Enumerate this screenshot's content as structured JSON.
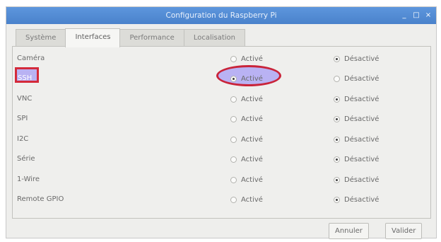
{
  "window": {
    "title": "Configuration du Raspberry Pi",
    "controls": {
      "minimize": "_",
      "maximize": "□",
      "close": "×"
    }
  },
  "tabs": [
    {
      "label": "Système",
      "active": false
    },
    {
      "label": "Interfaces",
      "active": true
    },
    {
      "label": "Performance",
      "active": false
    },
    {
      "label": "Localisation",
      "active": false
    }
  ],
  "options": {
    "enable_label": "Activé",
    "disable_label": "Désactivé"
  },
  "interfaces": [
    {
      "label": "Caméra",
      "enabled": false
    },
    {
      "label": "SSH",
      "enabled": true
    },
    {
      "label": "VNC",
      "enabled": false
    },
    {
      "label": "SPI",
      "enabled": false
    },
    {
      "label": "I2C",
      "enabled": false
    },
    {
      "label": "Série",
      "enabled": false
    },
    {
      "label": "1-Wire",
      "enabled": false
    },
    {
      "label": "Remote GPIO",
      "enabled": false
    }
  ],
  "buttons": {
    "cancel": "Annuler",
    "validate": "Valider"
  },
  "annotation_color": "#d42a3a",
  "highlight_color": "#b9b2f3"
}
